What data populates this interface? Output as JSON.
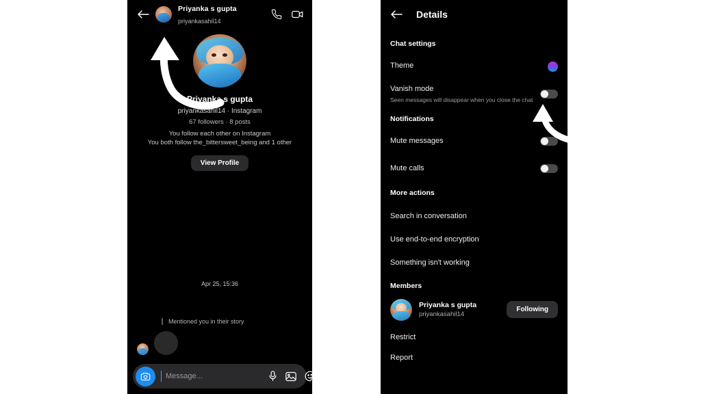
{
  "chat_panel": {
    "header": {
      "back_icon": "back-arrow-icon",
      "avatar": "contact-avatar",
      "name": "Priyanka s gupta",
      "username": "priyankasahil14",
      "call_icon": "phone-icon",
      "video_icon": "video-camera-icon"
    },
    "profile": {
      "avatar": "contact-large-avatar",
      "name": "Priyanka s gupta",
      "handle_line": "priyankasahil14 · Instagram",
      "stats": "67 followers · 8 posts",
      "relation_line1": "You follow each other on Instagram",
      "relation_line2": "You both follow the_bittersweet_being and 1 other",
      "view_profile_label": "View Profile"
    },
    "conversation": {
      "timestamp": "Apr 25, 15:36",
      "mention_label": "Mentioned you in their story",
      "story_bubble": "story-media-bubble"
    },
    "composer": {
      "camera_icon": "camera-icon",
      "placeholder": "Message...",
      "value": "",
      "mic_icon": "microphone-icon",
      "gallery_icon": "image-icon",
      "sticker_icon": "sticker-icon"
    }
  },
  "details_panel": {
    "header": {
      "back_icon": "back-arrow-icon",
      "title": "Details"
    },
    "sections": {
      "chat_settings_title": "Chat settings",
      "theme_label": "Theme",
      "theme_color": "#8b3ae0",
      "vanish_label": "Vanish mode",
      "vanish_sub": "Seen messages will disappear when you close the chat",
      "vanish_state": "off",
      "notifications_title": "Notifications",
      "mute_messages_label": "Mute messages",
      "mute_messages_state": "off",
      "mute_calls_label": "Mute calls",
      "mute_calls_state": "off",
      "more_actions_title": "More actions",
      "search_label": "Search in conversation",
      "encryption_label": "Use end-to-end encryption",
      "issue_label": "Something isn't working",
      "members_title": "Members",
      "member_name": "Priyanka s gupta",
      "member_username": "priyankasahil14",
      "following_label": "Following",
      "restrict_label": "Restrict",
      "report_label": "Report"
    }
  },
  "annotations": {
    "arrow_to_avatar": "highlight-arrow-profile-picture",
    "arrow_to_vanish_toggle": "highlight-arrow-vanish-toggle",
    "arrow_color": "#ffffff"
  }
}
